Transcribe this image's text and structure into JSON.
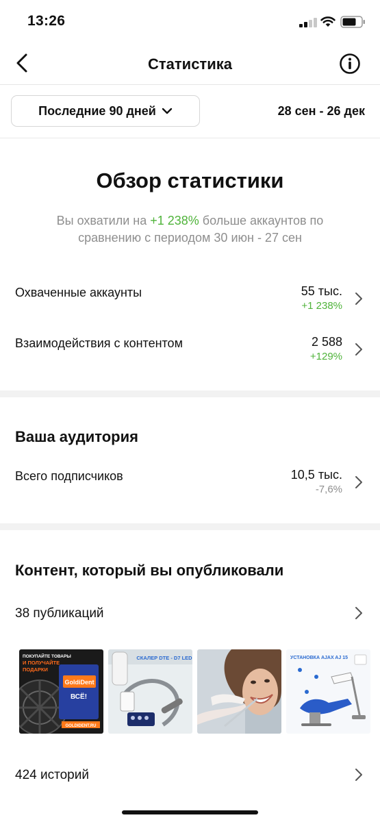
{
  "status": {
    "time": "13:26"
  },
  "nav": {
    "title": "Статистика"
  },
  "filter": {
    "period_label": "Последние 90 дней",
    "date_range": "28 сен - 26 дек"
  },
  "overview": {
    "title": "Обзор статистики",
    "subtitle_prefix": "Вы охватили на ",
    "subtitle_highlight": "+1 238%",
    "subtitle_suffix": " больше аккаунтов по сравнению с периодом 30 июн - 27 сен",
    "rows": [
      {
        "label": "Охваченные аккаунты",
        "value": "55 тыс.",
        "delta": "+1 238%"
      },
      {
        "label": "Взаимодействия с контентом",
        "value": "2 588",
        "delta": "+129%"
      }
    ]
  },
  "audience": {
    "title": "Ваша аудитория",
    "rows": [
      {
        "label": "Всего подписчиков",
        "value": "10,5 тыс.",
        "delta": "-7,6%"
      }
    ]
  },
  "content": {
    "title": "Контент, который вы опубликовали",
    "publications": "38 публикаций",
    "stories": "424 историй",
    "thumbnails": [
      {
        "line1": "ПОКУПАЙТЕ ТОВАРЫ",
        "line2": "И ПОЛУЧАЙТЕ",
        "line3": "ПОДАРКИ",
        "brand": "GoldiDent",
        "bag": "ВСЁ!",
        "footer": "GOLDIDENT.RU"
      },
      {
        "title": "СКАЛЕР DTE - D7 LED"
      },
      {
        "alt": "dentist-patient-photo"
      },
      {
        "title": "УСТАНОВКА AJAX AJ 15"
      }
    ]
  },
  "colors": {
    "positive": "#4fb33a",
    "muted": "#8e8e8e",
    "divider": "#f2f2f2"
  }
}
